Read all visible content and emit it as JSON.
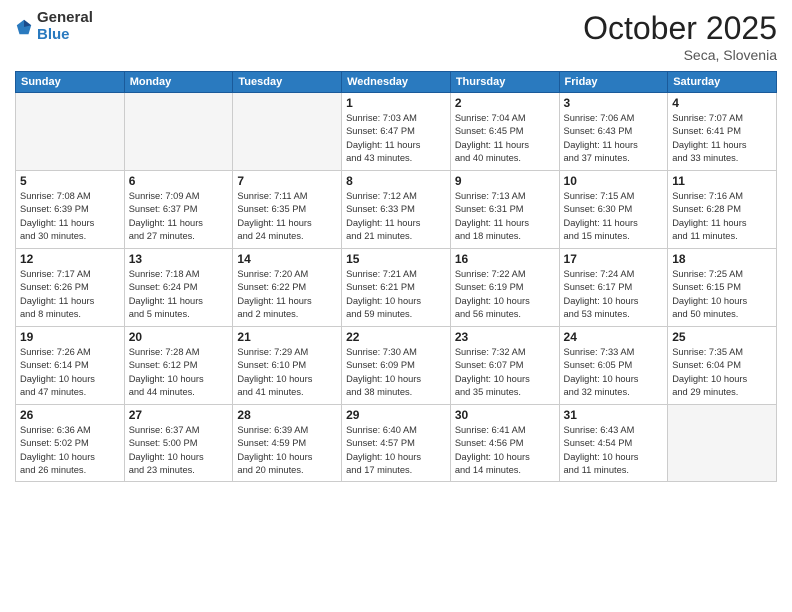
{
  "header": {
    "logo_general": "General",
    "logo_blue": "Blue",
    "month_title": "October 2025",
    "location": "Seca, Slovenia"
  },
  "weekdays": [
    "Sunday",
    "Monday",
    "Tuesday",
    "Wednesday",
    "Thursday",
    "Friday",
    "Saturday"
  ],
  "weeks": [
    [
      {
        "day": "",
        "info": ""
      },
      {
        "day": "",
        "info": ""
      },
      {
        "day": "",
        "info": ""
      },
      {
        "day": "1",
        "info": "Sunrise: 7:03 AM\nSunset: 6:47 PM\nDaylight: 11 hours\nand 43 minutes."
      },
      {
        "day": "2",
        "info": "Sunrise: 7:04 AM\nSunset: 6:45 PM\nDaylight: 11 hours\nand 40 minutes."
      },
      {
        "day": "3",
        "info": "Sunrise: 7:06 AM\nSunset: 6:43 PM\nDaylight: 11 hours\nand 37 minutes."
      },
      {
        "day": "4",
        "info": "Sunrise: 7:07 AM\nSunset: 6:41 PM\nDaylight: 11 hours\nand 33 minutes."
      }
    ],
    [
      {
        "day": "5",
        "info": "Sunrise: 7:08 AM\nSunset: 6:39 PM\nDaylight: 11 hours\nand 30 minutes."
      },
      {
        "day": "6",
        "info": "Sunrise: 7:09 AM\nSunset: 6:37 PM\nDaylight: 11 hours\nand 27 minutes."
      },
      {
        "day": "7",
        "info": "Sunrise: 7:11 AM\nSunset: 6:35 PM\nDaylight: 11 hours\nand 24 minutes."
      },
      {
        "day": "8",
        "info": "Sunrise: 7:12 AM\nSunset: 6:33 PM\nDaylight: 11 hours\nand 21 minutes."
      },
      {
        "day": "9",
        "info": "Sunrise: 7:13 AM\nSunset: 6:31 PM\nDaylight: 11 hours\nand 18 minutes."
      },
      {
        "day": "10",
        "info": "Sunrise: 7:15 AM\nSunset: 6:30 PM\nDaylight: 11 hours\nand 15 minutes."
      },
      {
        "day": "11",
        "info": "Sunrise: 7:16 AM\nSunset: 6:28 PM\nDaylight: 11 hours\nand 11 minutes."
      }
    ],
    [
      {
        "day": "12",
        "info": "Sunrise: 7:17 AM\nSunset: 6:26 PM\nDaylight: 11 hours\nand 8 minutes."
      },
      {
        "day": "13",
        "info": "Sunrise: 7:18 AM\nSunset: 6:24 PM\nDaylight: 11 hours\nand 5 minutes."
      },
      {
        "day": "14",
        "info": "Sunrise: 7:20 AM\nSunset: 6:22 PM\nDaylight: 11 hours\nand 2 minutes."
      },
      {
        "day": "15",
        "info": "Sunrise: 7:21 AM\nSunset: 6:21 PM\nDaylight: 10 hours\nand 59 minutes."
      },
      {
        "day": "16",
        "info": "Sunrise: 7:22 AM\nSunset: 6:19 PM\nDaylight: 10 hours\nand 56 minutes."
      },
      {
        "day": "17",
        "info": "Sunrise: 7:24 AM\nSunset: 6:17 PM\nDaylight: 10 hours\nand 53 minutes."
      },
      {
        "day": "18",
        "info": "Sunrise: 7:25 AM\nSunset: 6:15 PM\nDaylight: 10 hours\nand 50 minutes."
      }
    ],
    [
      {
        "day": "19",
        "info": "Sunrise: 7:26 AM\nSunset: 6:14 PM\nDaylight: 10 hours\nand 47 minutes."
      },
      {
        "day": "20",
        "info": "Sunrise: 7:28 AM\nSunset: 6:12 PM\nDaylight: 10 hours\nand 44 minutes."
      },
      {
        "day": "21",
        "info": "Sunrise: 7:29 AM\nSunset: 6:10 PM\nDaylight: 10 hours\nand 41 minutes."
      },
      {
        "day": "22",
        "info": "Sunrise: 7:30 AM\nSunset: 6:09 PM\nDaylight: 10 hours\nand 38 minutes."
      },
      {
        "day": "23",
        "info": "Sunrise: 7:32 AM\nSunset: 6:07 PM\nDaylight: 10 hours\nand 35 minutes."
      },
      {
        "day": "24",
        "info": "Sunrise: 7:33 AM\nSunset: 6:05 PM\nDaylight: 10 hours\nand 32 minutes."
      },
      {
        "day": "25",
        "info": "Sunrise: 7:35 AM\nSunset: 6:04 PM\nDaylight: 10 hours\nand 29 minutes."
      }
    ],
    [
      {
        "day": "26",
        "info": "Sunrise: 6:36 AM\nSunset: 5:02 PM\nDaylight: 10 hours\nand 26 minutes."
      },
      {
        "day": "27",
        "info": "Sunrise: 6:37 AM\nSunset: 5:00 PM\nDaylight: 10 hours\nand 23 minutes."
      },
      {
        "day": "28",
        "info": "Sunrise: 6:39 AM\nSunset: 4:59 PM\nDaylight: 10 hours\nand 20 minutes."
      },
      {
        "day": "29",
        "info": "Sunrise: 6:40 AM\nSunset: 4:57 PM\nDaylight: 10 hours\nand 17 minutes."
      },
      {
        "day": "30",
        "info": "Sunrise: 6:41 AM\nSunset: 4:56 PM\nDaylight: 10 hours\nand 14 minutes."
      },
      {
        "day": "31",
        "info": "Sunrise: 6:43 AM\nSunset: 4:54 PM\nDaylight: 10 hours\nand 11 minutes."
      },
      {
        "day": "",
        "info": ""
      }
    ]
  ]
}
